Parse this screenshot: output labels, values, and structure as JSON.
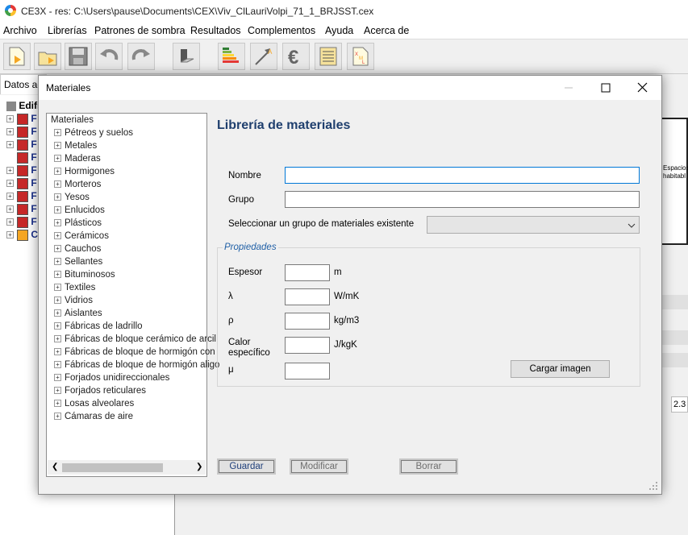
{
  "window": {
    "title": "CE3X - res: C:\\Users\\pause\\Documents\\CEX\\Viv_ClLauriVolpi_71_1_BRJSST.cex"
  },
  "menu": [
    "Archivo",
    "Librerías",
    "Patrones de sombra",
    "Resultados",
    "Complementos",
    "Ayuda",
    "Acerca de"
  ],
  "toolbar": {
    "icons": [
      "new-file-icon",
      "open-folder-icon",
      "save-icon",
      "undo-icon",
      "redo-icon",
      "3d-block-icon",
      "energy-rating-icon",
      "improve-arrow-icon",
      "euro-icon",
      "report-icon",
      "xml-icon"
    ]
  },
  "background": {
    "tab_label": "Datos ad",
    "tree_root": "Edifi",
    "tree_rows": [
      "F",
      "F",
      "F",
      "F",
      "F",
      "F",
      "F",
      "F",
      "F",
      "C"
    ],
    "right_text1": "Espacios",
    "right_text2": "habitabl",
    "right_value": "2.3"
  },
  "dialog": {
    "title": "Materiales",
    "tree": {
      "root": "Materiales",
      "items": [
        "Pétreos y suelos",
        "Metales",
        "Maderas",
        "Hormigones",
        "Morteros",
        "Yesos",
        "Enlucidos",
        "Plásticos",
        "Cerámicos",
        "Cauchos",
        "Sellantes",
        "Bituminosos",
        "Textiles",
        "Vidrios",
        "Aislantes",
        "Fábricas de ladrillo",
        "Fábricas de bloque cerámico de arcil",
        "Fábricas de bloque de hormigón con",
        "Fábricas de bloque de hormigón aligo",
        "Forjados unidireccionales",
        "Forjados reticulares",
        "Losas alveolares",
        "Cámaras de aire"
      ]
    },
    "header": "Librería de materiales",
    "form": {
      "nombre_label": "Nombre",
      "nombre_value": "",
      "grupo_label": "Grupo",
      "grupo_value": "",
      "select_label": "Seleccionar un grupo de materiales existente",
      "select_value": ""
    },
    "properties": {
      "title": "Propiedades",
      "rows": [
        {
          "label": "Espesor",
          "unit": "m",
          "value": ""
        },
        {
          "label": "λ",
          "unit": "W/mK",
          "value": ""
        },
        {
          "label": "ρ",
          "unit": "kg/m3",
          "value": ""
        },
        {
          "label": "Calor específico",
          "unit": "J/kgK",
          "value": ""
        },
        {
          "label": "μ",
          "unit": "",
          "value": ""
        }
      ],
      "load_image_button": "Cargar imagen"
    },
    "buttons": {
      "save": "Guardar",
      "modify": "Modificar",
      "delete": "Borrar"
    }
  },
  "colors": {
    "header": "#1f3f6e",
    "accent": "#0078d7",
    "group_title": "#1f5fa6"
  }
}
